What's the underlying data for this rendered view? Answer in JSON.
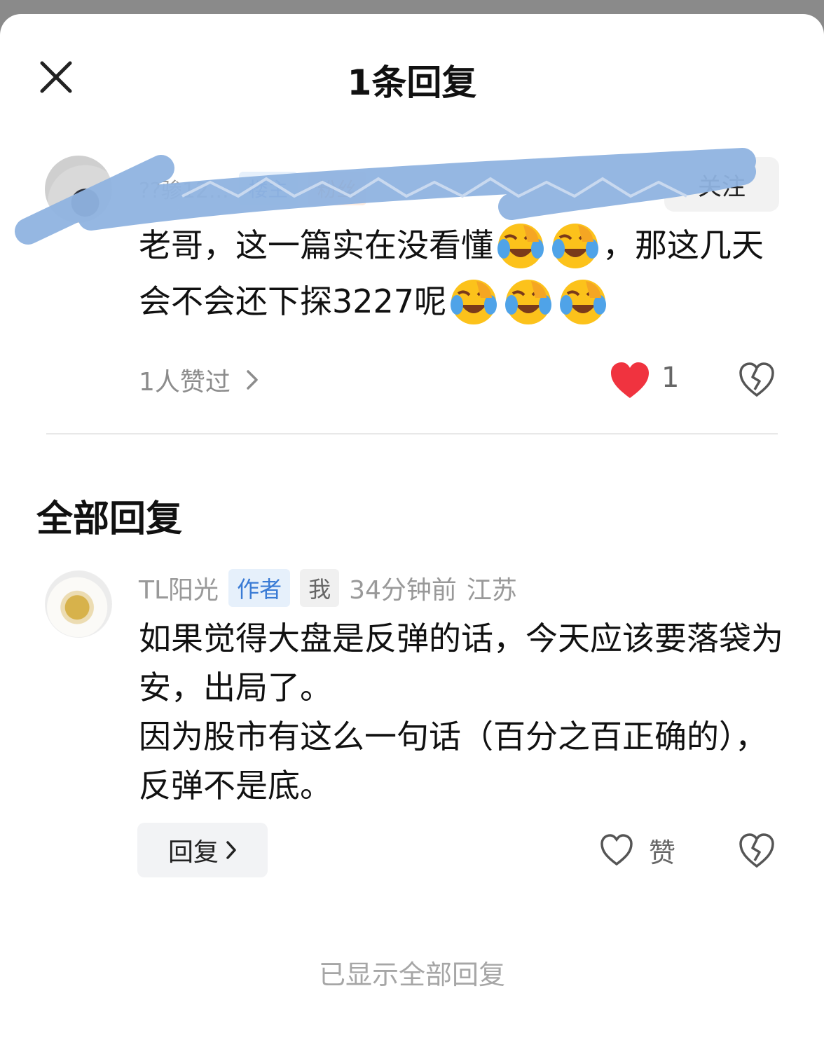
{
  "header": {
    "title": "1条回复",
    "close_icon": "close-icon"
  },
  "original_comment": {
    "username": "??骖12...",
    "tag_author": "楼主",
    "tag_fan": "粉丝",
    "follow_label": "关注",
    "text_part1": "老哥，这一篇实在没看懂",
    "text_part2": "，那这几天会不会还下探3227呢",
    "likes_text": "1人赞过",
    "like_count": "1"
  },
  "replies_section": {
    "title": "全部回复"
  },
  "reply": {
    "username": "TL阳光",
    "tag_author": "作者",
    "tag_me": "我",
    "time": "34分钟前",
    "location": "江苏",
    "text": "如果觉得大盘是反弹的话，今天应该要落袋为安，出局了。\n因为股市有这么一句话（百分之百正确的），反弹不是底。",
    "reply_button_label": "回复",
    "like_label": "赞"
  },
  "footer": {
    "note": "已显示全部回复"
  },
  "colors": {
    "accent_blue": "#3a7bd5",
    "heart_red": "#f0333f",
    "scribble_blue": "#8fb3e0"
  }
}
